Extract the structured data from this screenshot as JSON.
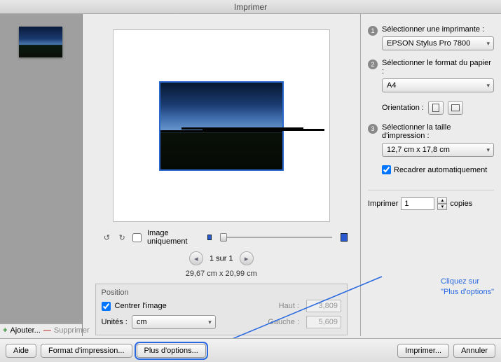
{
  "window": {
    "title": "Imprimer"
  },
  "sidebar": {
    "add_label": "Ajouter...",
    "remove_label": "Supprimer"
  },
  "center": {
    "image_only": "Image uniquement",
    "page_of": "1 sur 1",
    "dimensions": "29,67 cm x 20,99 cm",
    "position_title": "Position",
    "center_image": "Centrer l'image",
    "units_label": "Unités :",
    "units_value": "cm",
    "haut_label": "Haut :",
    "haut_value": "3,809",
    "gauche_label": "Gauche :",
    "gauche_value": "5,609"
  },
  "right": {
    "step1_label": "Sélectionner une imprimante :",
    "printer": "EPSON Stylus Pro 7800",
    "step2_label": "Sélectionner le format du papier :",
    "paper": "A4",
    "orientation_label": "Orientation :",
    "step3_label": "Sélectionner la taille d'impression :",
    "size": "12,7 cm x 17,8 cm",
    "autocrop": "Recadrer automatiquement",
    "copies_label_prefix": "Imprimer",
    "copies_value": "1",
    "copies_label_suffix": "copies"
  },
  "annotation": {
    "line1": "Cliquez sur",
    "line2": "\"Plus d'options\""
  },
  "buttons": {
    "help": "Aide",
    "print_format": "Format d'impression...",
    "more_options": "Plus d'options...",
    "print": "Imprimer...",
    "cancel": "Annuler"
  }
}
